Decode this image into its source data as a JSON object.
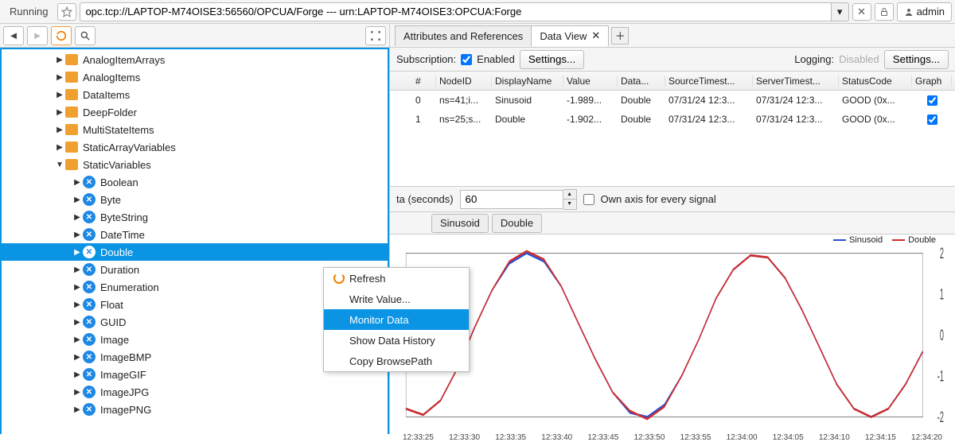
{
  "topbar": {
    "status": "Running",
    "address": "opc.tcp://LAPTOP-M74OISE3:56560/OPCUA/Forge --- urn:LAPTOP-M74OISE3:OPCUA:Forge",
    "user": "admin"
  },
  "tree": {
    "items": [
      {
        "label": "AnalogItemArrays",
        "type": "folder",
        "depth": 3,
        "exp": false
      },
      {
        "label": "AnalogItems",
        "type": "folder",
        "depth": 3,
        "exp": false
      },
      {
        "label": "DataItems",
        "type": "folder",
        "depth": 3,
        "exp": false
      },
      {
        "label": "DeepFolder",
        "type": "folder",
        "depth": 3,
        "exp": false
      },
      {
        "label": "MultiStateItems",
        "type": "folder",
        "depth": 3,
        "exp": false
      },
      {
        "label": "StaticArrayVariables",
        "type": "folder",
        "depth": 3,
        "exp": false
      },
      {
        "label": "StaticVariables",
        "type": "folder",
        "depth": 3,
        "exp": true
      },
      {
        "label": "Boolean",
        "type": "var",
        "depth": 4,
        "exp": false
      },
      {
        "label": "Byte",
        "type": "var",
        "depth": 4,
        "exp": false
      },
      {
        "label": "ByteString",
        "type": "var",
        "depth": 4,
        "exp": false
      },
      {
        "label": "DateTime",
        "type": "var",
        "depth": 4,
        "exp": false
      },
      {
        "label": "Double",
        "type": "var",
        "depth": 4,
        "exp": false,
        "selected": true
      },
      {
        "label": "Duration",
        "type": "var",
        "depth": 4,
        "exp": false
      },
      {
        "label": "Enumeration",
        "type": "var",
        "depth": 4,
        "exp": false
      },
      {
        "label": "Float",
        "type": "var",
        "depth": 4,
        "exp": false
      },
      {
        "label": "GUID",
        "type": "var",
        "depth": 4,
        "exp": false
      },
      {
        "label": "Image",
        "type": "var",
        "depth": 4,
        "exp": false
      },
      {
        "label": "ImageBMP",
        "type": "var",
        "depth": 4,
        "exp": false
      },
      {
        "label": "ImageGIF",
        "type": "var",
        "depth": 4,
        "exp": false
      },
      {
        "label": "ImageJPG",
        "type": "var",
        "depth": 4,
        "exp": false
      },
      {
        "label": "ImagePNG",
        "type": "var",
        "depth": 4,
        "exp": false
      }
    ]
  },
  "context_menu": {
    "items": [
      {
        "label": "Refresh",
        "icon": true
      },
      {
        "label": "Write Value..."
      },
      {
        "label": "Monitor Data",
        "highlight": true
      },
      {
        "label": "Show Data History"
      },
      {
        "label": "Copy BrowsePath"
      }
    ]
  },
  "right": {
    "tabs": [
      {
        "label": "Attributes and References",
        "active": false
      },
      {
        "label": "Data View",
        "active": true,
        "closable": true
      }
    ],
    "subscription": {
      "label": "Subscription:",
      "enabled_label": "Enabled",
      "settings_label": "Settings...",
      "logging_label": "Logging:",
      "logging_status": "Disabled"
    },
    "table": {
      "columns": [
        "",
        "#",
        "NodeID",
        "DisplayName",
        "Value",
        "Data...",
        "SourceTimest...",
        "ServerTimest...",
        "StatusCode",
        "Graph"
      ],
      "rows": [
        {
          "idx": "0",
          "node": "ns=41;i...",
          "name": "Sinusoid",
          "value": "-1.989...",
          "dtype": "Double",
          "src": "07/31/24 12:3...",
          "srv": "07/31/24 12:3...",
          "status": "GOOD (0x...",
          "graph": true
        },
        {
          "idx": "1",
          "node": "ns=25;s...",
          "name": "Double",
          "value": "-1.902...",
          "dtype": "Double",
          "src": "07/31/24 12:3...",
          "srv": "07/31/24 12:3...",
          "status": "GOOD (0x...",
          "graph": true
        }
      ]
    },
    "chart_controls": {
      "seconds_label": "ta (seconds)",
      "seconds_value": "60",
      "ownaxis_label": "Own axis for every signal"
    },
    "series_tabs": [
      "Sinusoid",
      "Double"
    ]
  },
  "chart_data": {
    "type": "line",
    "xlabel": "",
    "ylabel": "",
    "ylim": [
      -2,
      2
    ],
    "yticks": [
      -2,
      -1,
      0,
      1,
      2
    ],
    "xticks": [
      "12:33:25",
      "12:33:30",
      "12:33:35",
      "12:33:40",
      "12:33:45",
      "12:33:50",
      "12:33:55",
      "12:34:00",
      "12:34:05",
      "12:34:10",
      "12:34:15",
      "12:34:20"
    ],
    "series": [
      {
        "name": "Sinusoid",
        "color": "#2b4fd0",
        "values": [
          -1.8,
          -1.95,
          -1.6,
          -0.8,
          0.2,
          1.1,
          1.75,
          2.0,
          1.8,
          1.2,
          0.3,
          -0.6,
          -1.4,
          -1.9,
          -2.0,
          -1.7,
          -1.0,
          -0.1,
          0.9,
          1.6,
          1.95,
          1.9,
          1.4,
          0.6,
          -0.3,
          -1.2,
          -1.8,
          -2.0,
          -1.8,
          -1.2,
          -0.4
        ]
      },
      {
        "name": "Double",
        "color": "#d02b2b",
        "values": [
          -1.8,
          -1.95,
          -1.6,
          -0.8,
          0.2,
          1.1,
          1.8,
          2.05,
          1.85,
          1.2,
          0.3,
          -0.6,
          -1.4,
          -1.85,
          -2.05,
          -1.75,
          -1.0,
          -0.1,
          0.9,
          1.6,
          1.95,
          1.9,
          1.4,
          0.6,
          -0.3,
          -1.2,
          -1.8,
          -2.0,
          -1.8,
          -1.2,
          -0.4
        ]
      }
    ],
    "legend": [
      "Sinusoid",
      "Double"
    ]
  }
}
